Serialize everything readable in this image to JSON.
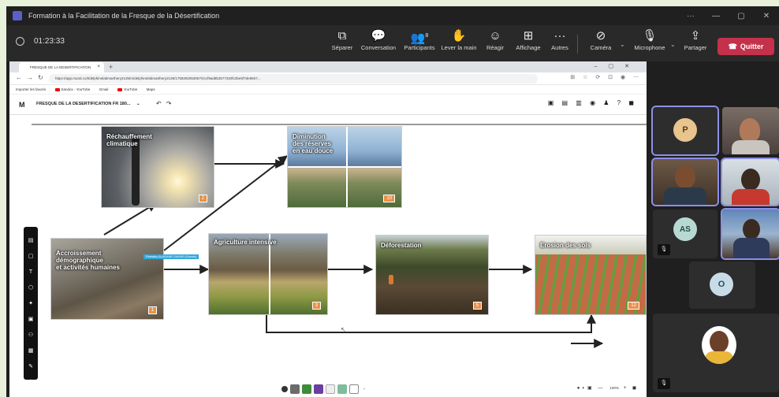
{
  "window": {
    "title": "Formation à la Facilitation de la Fresque de la Désertification"
  },
  "meeting": {
    "timer": "01:23:33",
    "participants_count": "8",
    "buttons": [
      {
        "id": "separer",
        "label": "Séparer",
        "icon": "picture-in-picture-icon"
      },
      {
        "id": "conversation",
        "label": "Conversation",
        "icon": "chat-icon"
      },
      {
        "id": "participants",
        "label": "Participants",
        "icon": "people-icon"
      },
      {
        "id": "lever",
        "label": "Lever la main",
        "icon": "raise-hand-icon"
      },
      {
        "id": "reagir",
        "label": "Réagir",
        "icon": "smiley-icon"
      },
      {
        "id": "affichage",
        "label": "Affichage",
        "icon": "grid-icon"
      },
      {
        "id": "autres",
        "label": "Autres",
        "icon": "more-icon"
      },
      {
        "id": "camera",
        "label": "Caméra",
        "icon": "camera-off-icon"
      },
      {
        "id": "microphone",
        "label": "Microphone",
        "icon": "mic-off-icon"
      },
      {
        "id": "partager",
        "label": "Partager",
        "icon": "share-icon"
      }
    ],
    "quit_label": "Quitter"
  },
  "browser": {
    "tab_title": "FRESQUE DE LA DESERTIFICATION",
    "url": "https://app.mural.co/t/delphinelabmarthery2135/m/delphinelabmarthery2135/1758292053067/2ccf9ad8b3577320fc2be5f7de8557...",
    "bookmarks": [
      "Importer les favoris",
      "Sandox - YouTube",
      "Gmail",
      "YouTube",
      "Maps"
    ]
  },
  "mural": {
    "logo": "M",
    "board_name": "FRESQUE DE LA DESERTIFICATION FR 180...",
    "cards": [
      {
        "id": "rechauffement",
        "label": "Réchauffement\nclimatique",
        "number": "2"
      },
      {
        "id": "diminution",
        "label": "Diminution\ndes réserves\nen eau douce",
        "number": "10"
      },
      {
        "id": "accroissement",
        "label": "Accroissement\ndémographique\net activités humaines",
        "number": "1"
      },
      {
        "id": "agriculture",
        "label": "Agriculture intensive",
        "number": "3"
      },
      {
        "id": "deforestation",
        "label": "Déforestation",
        "number": "5"
      },
      {
        "id": "erosion",
        "label": "Erosion des sols",
        "number": "12"
      }
    ],
    "cursor_tag": "Ramatou ALADANE ZAKARI (Guests)",
    "zoom": "100%"
  },
  "participants": [
    {
      "id": "p",
      "initials": "P",
      "color": "#e8c48f"
    },
    {
      "id": "as",
      "initials": "AS",
      "color": "#b7d9d2"
    },
    {
      "id": "o",
      "initials": "O",
      "color": "#c8dce8"
    }
  ]
}
